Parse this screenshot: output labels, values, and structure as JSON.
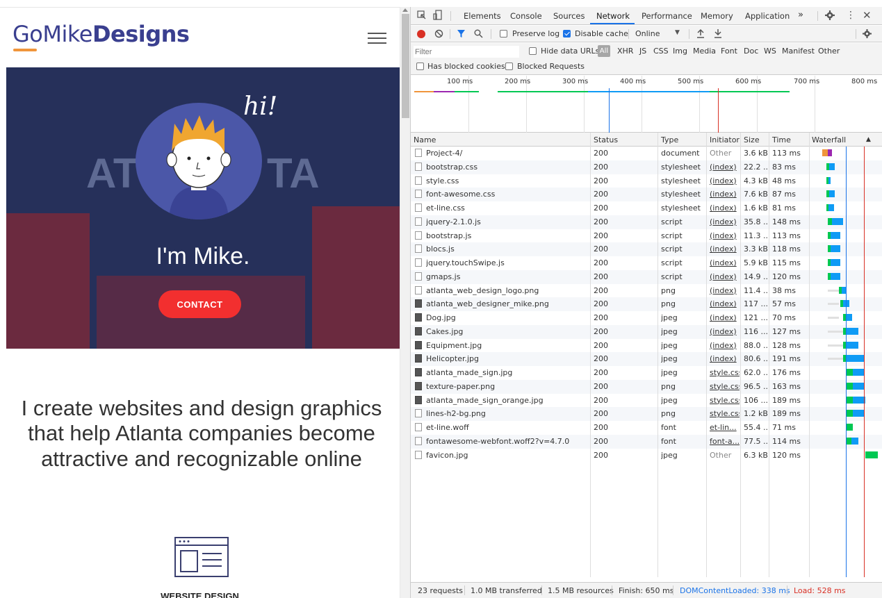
{
  "site": {
    "logo_go": "GoMike",
    "logo_designs": "Designs",
    "hero_hi": "hi!",
    "hero_wall_left": "AT",
    "hero_wall_right": "TA",
    "hero_title": "I'm Mike.",
    "contact_label": "CONTACT",
    "tagline": "I create websites and design graphics that help Atlanta companies become attractive and recognizable online",
    "service_label": "WEBSITE DESIGN"
  },
  "devtools": {
    "tabs": [
      "Elements",
      "Console",
      "Sources",
      "Network",
      "Performance",
      "Memory",
      "Application"
    ],
    "more_tabs": "»",
    "active_tab": "Network",
    "toolbar": {
      "preserve_log": "Preserve log",
      "disable_cache": "Disable cache",
      "throttling": "Online"
    },
    "filter": {
      "placeholder": "Filter",
      "hide_data_urls": "Hide data URLs",
      "all": "All",
      "types": [
        "XHR",
        "JS",
        "CSS",
        "Img",
        "Media",
        "Font",
        "Doc",
        "WS",
        "Manifest",
        "Other"
      ],
      "has_blocked_cookies": "Has blocked cookies",
      "blocked_requests": "Blocked Requests"
    },
    "overview_ticks": [
      "100 ms",
      "200 ms",
      "300 ms",
      "400 ms",
      "500 ms",
      "600 ms",
      "700 ms",
      "800 ms"
    ],
    "columns": [
      "Name",
      "Status",
      "Type",
      "Initiator",
      "Size",
      "Time",
      "Waterfall"
    ],
    "requests": [
      {
        "name": "Project-4/",
        "status": "200",
        "type": "document",
        "initiator": "Other",
        "size": "3.6 kB",
        "time": "113 ms",
        "icon": "doc"
      },
      {
        "name": "bootstrap.css",
        "status": "200",
        "type": "stylesheet",
        "initiator": "(index)",
        "size": "22.2 ...",
        "time": "83 ms",
        "icon": "doc"
      },
      {
        "name": "style.css",
        "status": "200",
        "type": "stylesheet",
        "initiator": "(index)",
        "size": "4.3 kB",
        "time": "48 ms",
        "icon": "doc"
      },
      {
        "name": "font-awesome.css",
        "status": "200",
        "type": "stylesheet",
        "initiator": "(index)",
        "size": "7.6 kB",
        "time": "87 ms",
        "icon": "doc"
      },
      {
        "name": "et-line.css",
        "status": "200",
        "type": "stylesheet",
        "initiator": "(index)",
        "size": "1.6 kB",
        "time": "81 ms",
        "icon": "doc"
      },
      {
        "name": "jquery-2.1.0.js",
        "status": "200",
        "type": "script",
        "initiator": "(index)",
        "size": "35.8 ...",
        "time": "148 ms",
        "icon": "doc"
      },
      {
        "name": "bootstrap.js",
        "status": "200",
        "type": "script",
        "initiator": "(index)",
        "size": "11.3 ...",
        "time": "113 ms",
        "icon": "doc"
      },
      {
        "name": "blocs.js",
        "status": "200",
        "type": "script",
        "initiator": "(index)",
        "size": "3.3 kB",
        "time": "118 ms",
        "icon": "doc"
      },
      {
        "name": "jquery.touchSwipe.js",
        "status": "200",
        "type": "script",
        "initiator": "(index)",
        "size": "5.9 kB",
        "time": "115 ms",
        "icon": "doc"
      },
      {
        "name": "gmaps.js",
        "status": "200",
        "type": "script",
        "initiator": "(index)",
        "size": "14.9 ...",
        "time": "120 ms",
        "icon": "doc"
      },
      {
        "name": "atlanta_web_design_logo.png",
        "status": "200",
        "type": "png",
        "initiator": "(index)",
        "size": "11.4 ...",
        "time": "38 ms",
        "icon": "doc"
      },
      {
        "name": "atlanta_web_designer_mike.png",
        "status": "200",
        "type": "png",
        "initiator": "(index)",
        "size": "117 ...",
        "time": "57 ms",
        "icon": "img"
      },
      {
        "name": "Dog.jpg",
        "status": "200",
        "type": "jpeg",
        "initiator": "(index)",
        "size": "121 ...",
        "time": "70 ms",
        "icon": "img"
      },
      {
        "name": "Cakes.jpg",
        "status": "200",
        "type": "jpeg",
        "initiator": "(index)",
        "size": "116 ...",
        "time": "127 ms",
        "icon": "img"
      },
      {
        "name": "Equipment.jpg",
        "status": "200",
        "type": "jpeg",
        "initiator": "(index)",
        "size": "88.0 ...",
        "time": "128 ms",
        "icon": "img"
      },
      {
        "name": "Helicopter.jpg",
        "status": "200",
        "type": "jpeg",
        "initiator": "(index)",
        "size": "80.6 ...",
        "time": "191 ms",
        "icon": "img"
      },
      {
        "name": "atlanta_made_sign.jpg",
        "status": "200",
        "type": "jpeg",
        "initiator": "style.css",
        "size": "62.0 ...",
        "time": "176 ms",
        "icon": "img"
      },
      {
        "name": "texture-paper.png",
        "status": "200",
        "type": "png",
        "initiator": "style.css",
        "size": "96.5 ...",
        "time": "163 ms",
        "icon": "img"
      },
      {
        "name": "atlanta_made_sign_orange.jpg",
        "status": "200",
        "type": "jpeg",
        "initiator": "style.css",
        "size": "106 ...",
        "time": "189 ms",
        "icon": "img"
      },
      {
        "name": "lines-h2-bg.png",
        "status": "200",
        "type": "png",
        "initiator": "style.css",
        "size": "1.2 kB",
        "time": "189 ms",
        "icon": "doc"
      },
      {
        "name": "et-line.woff",
        "status": "200",
        "type": "font",
        "initiator": "et-lin...",
        "size": "55.4 ...",
        "time": "71 ms",
        "icon": "doc"
      },
      {
        "name": "fontawesome-webfont.woff2?v=4.7.0",
        "status": "200",
        "type": "font",
        "initiator": "font-a...",
        "size": "77.5 ...",
        "time": "114 ms",
        "icon": "doc"
      },
      {
        "name": "favicon.jpg",
        "status": "200",
        "type": "jpeg",
        "initiator": "Other",
        "size": "6.3 kB",
        "time": "120 ms",
        "icon": "doc"
      }
    ],
    "status": {
      "requests": "23 requests",
      "transferred": "1.0 MB transferred",
      "resources": "1.5 MB resources",
      "finish": "Finish: 650 ms",
      "dom_content_loaded": "DOMContentLoaded: 338 ms",
      "load": "Load: 528 ms"
    },
    "colors": {
      "accent": "#1a73e8",
      "dcl_line": "#1a73e8",
      "load_line": "#d93025",
      "waterfall_wait": "#00c853",
      "waterfall_download": "#0f9bf5"
    }
  }
}
